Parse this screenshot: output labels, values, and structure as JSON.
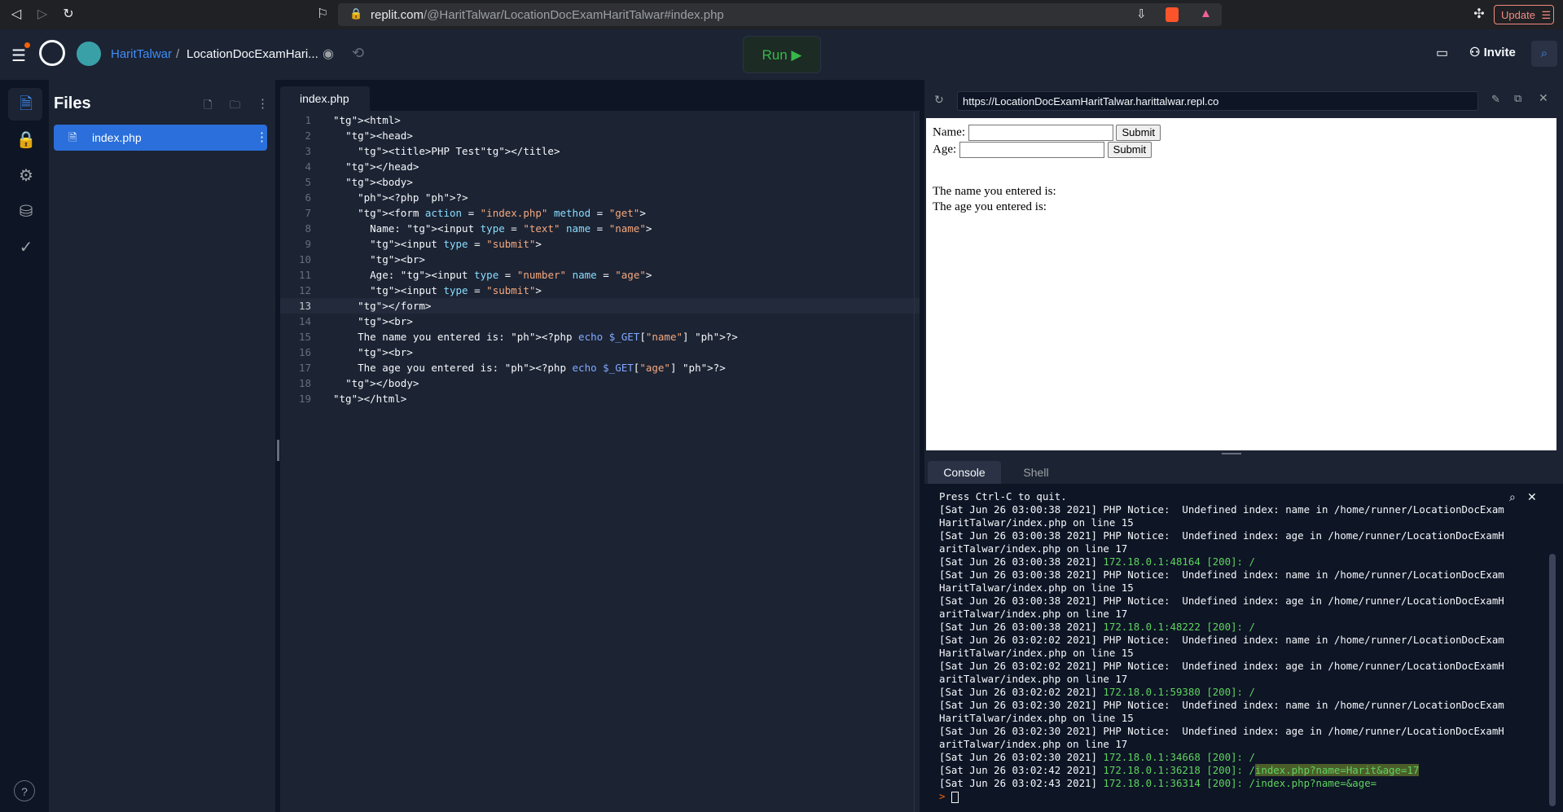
{
  "browser": {
    "url_host": "replit.com",
    "url_path": "/@HaritTalwar/LocationDocExamHaritTalwar#index.php",
    "update_label": "Update"
  },
  "header": {
    "user": "HaritTalwar",
    "separator": "/",
    "repl_name": "LocationDocExamHari...",
    "run_label": "Run ▶",
    "invite_label": "Invite"
  },
  "files": {
    "title": "Files",
    "items": [
      {
        "label": "index.php"
      }
    ]
  },
  "editor": {
    "tab": "index.php",
    "active_line": 13,
    "lines": [
      {
        "n": "1",
        "code": "<html>"
      },
      {
        "n": "2",
        "code": "  <head>"
      },
      {
        "n": "3",
        "code": "    <title>PHP Test</title>"
      },
      {
        "n": "4",
        "code": "  </head>"
      },
      {
        "n": "5",
        "code": "  <body>"
      },
      {
        "n": "6",
        "code": "    <?php ?>"
      },
      {
        "n": "7",
        "code": "    <form action = \"index.php\" method = \"get\">"
      },
      {
        "n": "8",
        "code": "      Name: <input type = \"text\" name = \"name\">"
      },
      {
        "n": "9",
        "code": "      <input type = \"submit\">"
      },
      {
        "n": "10",
        "code": "      <br>"
      },
      {
        "n": "11",
        "code": "      Age: <input type = \"number\" name = \"age\">"
      },
      {
        "n": "12",
        "code": "      <input type = \"submit\">"
      },
      {
        "n": "13",
        "code": "    </form>"
      },
      {
        "n": "14",
        "code": "    <br>"
      },
      {
        "n": "15",
        "code": "    The name you entered is: <?php echo $_GET[\"name\"] ?>"
      },
      {
        "n": "16",
        "code": "    <br>"
      },
      {
        "n": "17",
        "code": "    The age you entered is: <?php echo $_GET[\"age\"] ?>"
      },
      {
        "n": "18",
        "code": "  </body>"
      },
      {
        "n": "19",
        "code": "</html>"
      }
    ]
  },
  "preview": {
    "url": "https://LocationDocExamHaritTalwar.harittalwar.repl.co",
    "name_label": "Name:",
    "age_label": "Age:",
    "submit_label": "Submit",
    "name_result": "The name you entered is:",
    "age_result": "The age you entered is:"
  },
  "console": {
    "tabs": [
      "Console",
      "Shell"
    ],
    "lines": [
      {
        "text": "Press Ctrl-C to quit."
      },
      {
        "text": "[Sat Jun 26 03:00:38 2021] PHP Notice:  Undefined index: name in /home/runner/LocationDocExam"
      },
      {
        "text": "HaritTalwar/index.php on line 15"
      },
      {
        "text": "[Sat Jun 26 03:00:38 2021] PHP Notice:  Undefined index: age in /home/runner/LocationDocExamH"
      },
      {
        "text": "aritTalwar/index.php on line 17"
      },
      {
        "text": "[Sat Jun 26 03:00:38 2021] ",
        "green": "172.18.0.1:48164 [200]: /"
      },
      {
        "text": "[Sat Jun 26 03:00:38 2021] PHP Notice:  Undefined index: name in /home/runner/LocationDocExam"
      },
      {
        "text": "HaritTalwar/index.php on line 15"
      },
      {
        "text": "[Sat Jun 26 03:00:38 2021] PHP Notice:  Undefined index: age in /home/runner/LocationDocExamH"
      },
      {
        "text": "aritTalwar/index.php on line 17"
      },
      {
        "text": "[Sat Jun 26 03:00:38 2021] ",
        "green": "172.18.0.1:48222 [200]: /"
      },
      {
        "text": "[Sat Jun 26 03:02:02 2021] PHP Notice:  Undefined index: name in /home/runner/LocationDocExam"
      },
      {
        "text": "HaritTalwar/index.php on line 15"
      },
      {
        "text": "[Sat Jun 26 03:02:02 2021] PHP Notice:  Undefined index: age in /home/runner/LocationDocExamH"
      },
      {
        "text": "aritTalwar/index.php on line 17"
      },
      {
        "text": "[Sat Jun 26 03:02:02 2021] ",
        "green": "172.18.0.1:59380 [200]: /"
      },
      {
        "text": "[Sat Jun 26 03:02:30 2021] PHP Notice:  Undefined index: name in /home/runner/LocationDocExam"
      },
      {
        "text": "HaritTalwar/index.php on line 15"
      },
      {
        "text": "[Sat Jun 26 03:02:30 2021] PHP Notice:  Undefined index: age in /home/runner/LocationDocExamH"
      },
      {
        "text": "aritTalwar/index.php on line 17"
      },
      {
        "text": "[Sat Jun 26 03:02:30 2021] ",
        "green": "172.18.0.1:34668 [200]: /"
      },
      {
        "text": "[Sat Jun 26 03:02:42 2021] ",
        "green": "172.18.0.1:36218 [200]: /",
        "highlight": "index.php?name=Harit&age=17"
      },
      {
        "text": "[Sat Jun 26 03:02:43 2021] ",
        "green": "172.18.0.1:36314 [200]: /index.php?name=&age="
      }
    ],
    "prompt": ">"
  }
}
